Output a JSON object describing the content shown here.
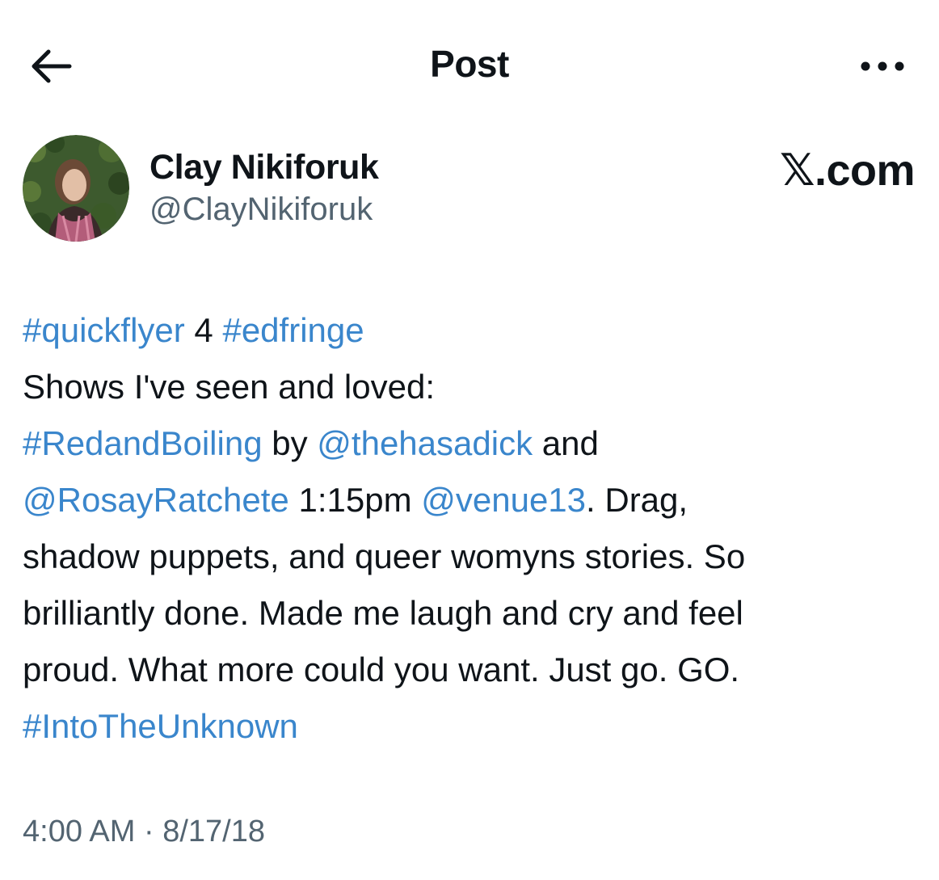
{
  "header": {
    "back_icon": "arrow-left-icon",
    "title": "Post",
    "more_icon": "more-horizontal-icon"
  },
  "author": {
    "name": "Clay Nikiforuk",
    "handle": "@ClayNikiforuk",
    "avatar_icon": "profile-photo"
  },
  "source": {
    "logo_mark": "𝕏",
    "logo_text": ".com"
  },
  "post": {
    "lines": [
      [
        {
          "text": "#quickflyer",
          "link": true
        },
        {
          "text": " 4 "
        },
        {
          "text": "#edfringe",
          "link": true
        }
      ],
      [
        {
          "text": "Shows I've seen and loved:"
        }
      ],
      [
        {
          "text": "#RedandBoiling",
          "link": true
        },
        {
          "text": " by "
        },
        {
          "text": "@thehasadick",
          "link": true
        },
        {
          "text": " and"
        }
      ],
      [
        {
          "text": "@RosayRatchete",
          "link": true
        },
        {
          "text": " 1:15pm "
        },
        {
          "text": "@venue13",
          "link": true
        },
        {
          "text": ". Drag,"
        }
      ],
      [
        {
          "text": "shadow puppets, and queer womyns stories. So"
        }
      ],
      [
        {
          "text": "brilliantly done. Made me laugh and cry and feel"
        }
      ],
      [
        {
          "text": "proud. What more could you want. Just go. GO."
        }
      ],
      [
        {
          "text": "#IntoTheUnknown",
          "link": true
        }
      ]
    ]
  },
  "timestamp": "4:00 AM · 8/17/18",
  "colors": {
    "link": "#3a86cc",
    "text": "#0f1419",
    "secondary": "#536471"
  }
}
